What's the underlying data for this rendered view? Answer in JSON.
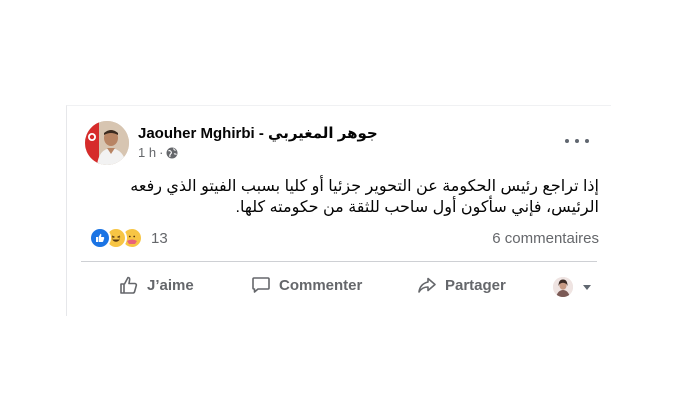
{
  "post": {
    "author": "Jaouher Mghirbi - جوهر المغيربي",
    "time": "1 h",
    "separator": "·",
    "text": "إذا تراجع رئيس الحكومة عن التحوير جزئيا أو كليا بسبب الفيتو الذي رفعه الرئيس، فإني سأكون أول ساحب للثقة من حكومته كلها.",
    "audience_icon": "globe-icon"
  },
  "reactions": {
    "types": [
      "like",
      "haha",
      "care"
    ],
    "count": "13",
    "comments": "6 commentaires"
  },
  "actions": {
    "like_label": "J’aime",
    "comment_label": "Commenter",
    "share_label": "Partager"
  },
  "colors": {
    "like_blue": "#1b74e4",
    "text": "#050505",
    "secondary": "#65676b"
  }
}
